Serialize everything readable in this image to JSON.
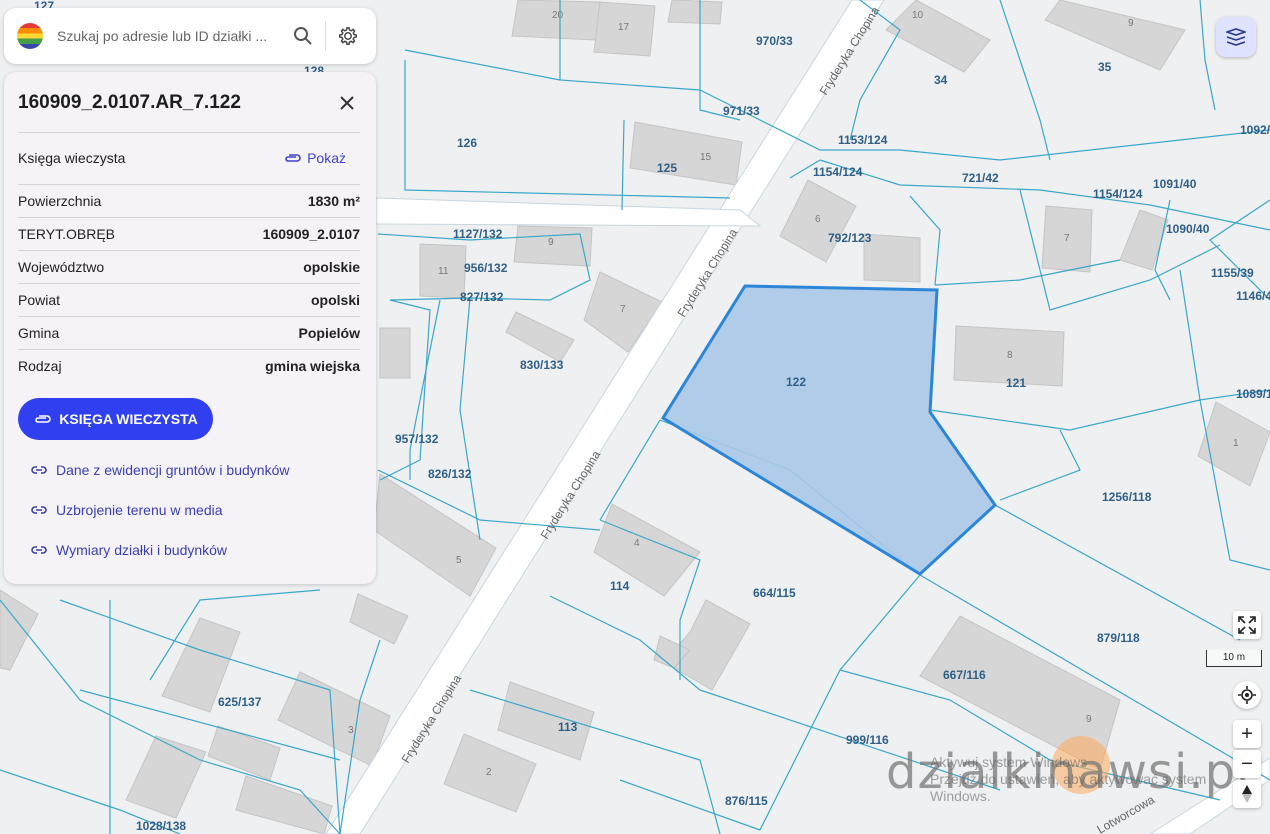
{
  "search": {
    "placeholder": "Szukaj po adresie lub ID działki ..."
  },
  "panel": {
    "title": "160909_2.0107.AR_7.122",
    "kw_label": "Księga wieczysta",
    "kw_action": "Pokaż",
    "rows": [
      {
        "label": "Powierzchnia",
        "value": "1830 m²"
      },
      {
        "label": "TERYT.OBRĘB",
        "value": "160909_2.0107"
      },
      {
        "label": "Województwo",
        "value": "opolskie"
      },
      {
        "label": "Powiat",
        "value": "opolski"
      },
      {
        "label": "Gmina",
        "value": "Popielów"
      },
      {
        "label": "Rodzaj",
        "value": "gmina wiejska"
      }
    ],
    "button": "KSIĘGA WIECZYSTA",
    "links": [
      "Dane z ewidencji gruntów i budynków",
      "Uzbrojenie terenu w media",
      "Wymiary działki i budynków"
    ]
  },
  "map": {
    "streets": [
      "Fryderyka Chopina",
      "Fryderyka Chopina",
      "Fryderyka Chopina",
      "Fryderyka Chopina",
      "Fryderyka Chopina",
      "Lotworcowa"
    ],
    "selected_parcel": "122",
    "parcels": [
      "127",
      "128",
      "970/33",
      "971/33",
      "126",
      "125",
      "1153/124",
      "1154/124",
      "721/42",
      "1154/124",
      "1091/40",
      "1090/40",
      "1155/39",
      "1146/4",
      "1092/",
      "35",
      "34",
      "1127/132",
      "956/132",
      "827/132",
      "792/123",
      "830/133",
      "957/132",
      "826/132",
      "121",
      "1089/1",
      "1256/118",
      "114",
      "664/115",
      "879/118",
      "625/137",
      "667/116",
      "113",
      "999/116",
      "876/115",
      "1028/138"
    ],
    "buildings": [
      "20",
      "17",
      "10",
      "9",
      "15",
      "6",
      "7",
      "9",
      "11",
      "7",
      "8",
      "1",
      "4",
      "5",
      "3",
      "2",
      "9"
    ],
    "scale": "10 m",
    "colors": {
      "parcel_line": "#3aa7c9",
      "selection_fill": "#a9c8e7",
      "selection_stroke": "#2b86d8",
      "accent": "#3040f0"
    }
  },
  "watermark": {
    "text": "dzialkinawsi.pl",
    "windows_line1": "Aktywuj system Windows",
    "windows_line2": "Przejdź do ustawień, aby aktywować system",
    "windows_line3": "Windows."
  }
}
